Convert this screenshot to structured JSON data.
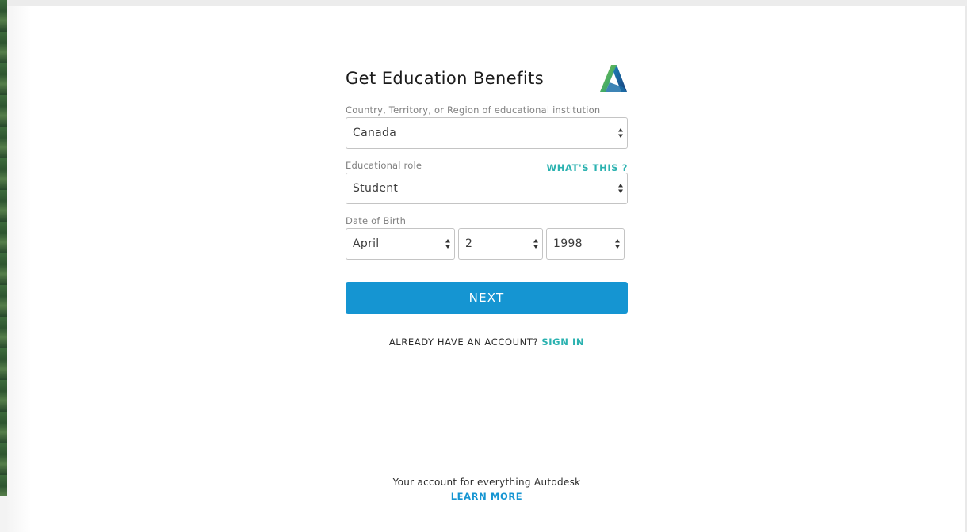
{
  "form": {
    "title": "Get Education Benefits",
    "country_label": "Country, Territory, or Region of educational institution",
    "country_value": "Canada",
    "role_label": "Educational role",
    "role_help": "WHAT'S THIS ?",
    "role_value": "Student",
    "dob_label": "Date of Birth",
    "dob_month": "April",
    "dob_day": "2",
    "dob_year": "1998",
    "next_label": "NEXT",
    "account_prompt": "ALREADY HAVE AN ACCOUNT?",
    "sign_in_label": "SIGN IN"
  },
  "footer": {
    "text": "Your account for everything Autodesk",
    "link": "LEARN MORE"
  },
  "colors": {
    "primary": "#1595d2",
    "link_teal": "#2bb2b0",
    "border": "#c4c4c4"
  }
}
